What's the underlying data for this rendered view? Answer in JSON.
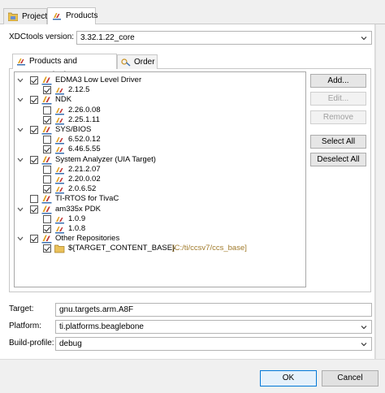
{
  "tabs": [
    {
      "label": "Project",
      "icon": "project-icon",
      "active": false
    },
    {
      "label": "Products",
      "icon": "products-icon",
      "active": true
    }
  ],
  "xdc": {
    "label": "XDCtools version:",
    "value": "3.32.1.22_core"
  },
  "subtabs": [
    {
      "label": "Products and Repositories",
      "icon": "products-icon",
      "active": true
    },
    {
      "label": "Order",
      "icon": "order-icon",
      "active": false
    }
  ],
  "tree": [
    {
      "level": 0,
      "expandable": true,
      "checked": true,
      "icon": "product-icon",
      "label": "EDMA3 Low Level Driver"
    },
    {
      "level": 1,
      "checked": true,
      "icon": "version-icon",
      "label": "2.12.5"
    },
    {
      "level": 0,
      "expandable": true,
      "checked": true,
      "icon": "product-icon",
      "label": "NDK"
    },
    {
      "level": 1,
      "checked": false,
      "icon": "version-icon",
      "label": "2.26.0.08"
    },
    {
      "level": 1,
      "checked": true,
      "icon": "version-icon",
      "label": "2.25.1.11"
    },
    {
      "level": 0,
      "expandable": true,
      "checked": true,
      "icon": "product-icon",
      "label": "SYS/BIOS"
    },
    {
      "level": 1,
      "checked": false,
      "icon": "version-icon",
      "label": "6.52.0.12"
    },
    {
      "level": 1,
      "checked": true,
      "icon": "version-icon",
      "label": "6.46.5.55"
    },
    {
      "level": 0,
      "expandable": true,
      "checked": true,
      "icon": "product-icon",
      "label": "System Analyzer (UIA Target)"
    },
    {
      "level": 1,
      "checked": false,
      "icon": "version-icon",
      "label": "2.21.2.07"
    },
    {
      "level": 1,
      "checked": false,
      "icon": "version-icon",
      "label": "2.20.0.02"
    },
    {
      "level": 1,
      "checked": true,
      "icon": "version-icon",
      "label": "2.0.6.52"
    },
    {
      "level": 0,
      "expandable": false,
      "checked": false,
      "icon": "product-icon",
      "label": "TI-RTOS for TivaC"
    },
    {
      "level": 0,
      "expandable": true,
      "checked": true,
      "icon": "product-icon",
      "label": "am335x PDK"
    },
    {
      "level": 1,
      "checked": false,
      "icon": "version-icon",
      "label": "1.0.9"
    },
    {
      "level": 1,
      "checked": true,
      "icon": "version-icon",
      "label": "1.0.8"
    },
    {
      "level": 0,
      "expandable": true,
      "checked": true,
      "icon": "product-icon",
      "label": "Other Repositories"
    },
    {
      "level": 1,
      "checked": true,
      "icon": "folder-icon",
      "label": "${TARGET_CONTENT_BASE}",
      "path": "[C:/ti/ccsv7/ccs_base]"
    }
  ],
  "buttons": [
    {
      "label": "Add...",
      "enabled": true
    },
    {
      "label": "Edit...",
      "enabled": false
    },
    {
      "label": "Remove",
      "enabled": false
    },
    {
      "label": "Select All",
      "enabled": true
    },
    {
      "label": "Deselect All",
      "enabled": true
    }
  ],
  "target": {
    "label": "Target:",
    "value": "gnu.targets.arm.A8F"
  },
  "platform": {
    "label": "Platform:",
    "value": "ti.platforms.beaglebone"
  },
  "profile": {
    "label": "Build-profile:",
    "value": "debug"
  },
  "dialog": {
    "ok": "OK",
    "cancel": "Cancel"
  },
  "colors": {
    "accent": "#0078d7",
    "path_text": "#a07a2a"
  }
}
